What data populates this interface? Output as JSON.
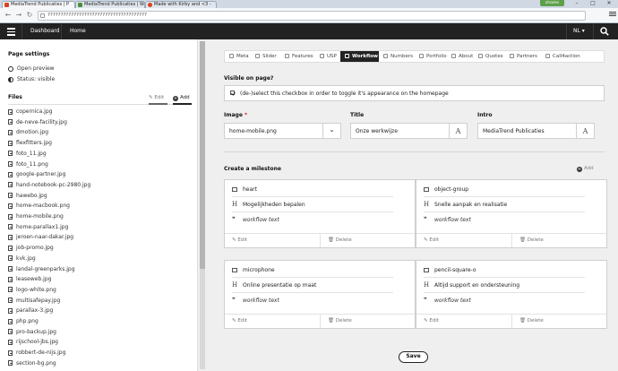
{
  "browser": {
    "tabs": [
      {
        "title": "MediaTrend Publicaties | P",
        "color": "#d9431e"
      },
      {
        "title": "MediaTrend Publicaties | W",
        "color": "#4b8f3a"
      },
      {
        "title": "Made with Kirby and <3 -",
        "color": "#d9431e"
      }
    ],
    "user_badge": "shame",
    "url": "??????????????????????????????????????",
    "window_controls": [
      "–",
      "□",
      "✕"
    ]
  },
  "topbar": {
    "crumbs": [
      "Dashboard",
      "Home"
    ],
    "language": "NL",
    "language_caret": "▾"
  },
  "sidebar": {
    "settings_title": "Page settings",
    "settings": [
      {
        "label": "Open preview",
        "icon": "preview-icon"
      },
      {
        "label": "Status: visible",
        "icon": "status-icon"
      }
    ],
    "files_title": "Files",
    "edit_label": "Edit",
    "add_label": "Add",
    "files": [
      "copernica.jpg",
      "de-neve-facility.jpg",
      "dmotion.jpg",
      "flexfitters.jpg",
      "foto_11.jpg",
      "foto_11.png",
      "google-partner.jpg",
      "hand-notebook-pc-2980.jpg",
      "hawebo.jpg",
      "home-macbook.png",
      "home-mobile.png",
      "home-parallax1.jpg",
      "jeroen-naar-dakar.jpg",
      "job-promo.jpg",
      "kvk.jpg",
      "landal-greenparks.jpg",
      "leaseweb.jpg",
      "logo-white.png",
      "multisafepay.jpg",
      "parallax-3.jpg",
      "php.png",
      "pro-backup.jpg",
      "rijschool-jbs.jpg",
      "robbert-de-nijs.jpg",
      "section-bg.png"
    ]
  },
  "tabs": [
    "Meta",
    "Slider",
    "Features",
    "USP",
    "Workflow",
    "Numbers",
    "Portfolio",
    "About",
    "Quotes",
    "Partners",
    "Call4action"
  ],
  "form": {
    "visible_label": "Visible on page?",
    "checkbox_text": "(de-)select this checkbox in order to toggle it's appearance on the homepage",
    "image_label": "Image",
    "image_required": "*",
    "image_value": "home-mobile.png",
    "image_caret": "⌄",
    "title_label": "Title",
    "title_value": "Onze werkwijze",
    "intro_label": "Intro",
    "intro_value": "MediaTrend Publicaties",
    "text_icon": "A",
    "milestone_label": "Create a milestone",
    "add_label": "Add",
    "save_label": "Save"
  },
  "milestones": [
    {
      "icon": "heart",
      "title": "Mogelijkheden bepalen",
      "text": "workflow text"
    },
    {
      "icon": "object-group",
      "title": "Snelle aanpak en realisatie",
      "text": "workflow text"
    },
    {
      "icon": "microphone",
      "title": "Online presentatie op maat",
      "text": "workflow text"
    },
    {
      "icon": "pencil-square-o",
      "title": "Altijd support en ondersteuning",
      "text": "workflow text"
    }
  ],
  "card_actions": {
    "edit": "Edit",
    "delete": "Delete",
    "title_glyph": "H",
    "quote_glyph": "❞"
  }
}
